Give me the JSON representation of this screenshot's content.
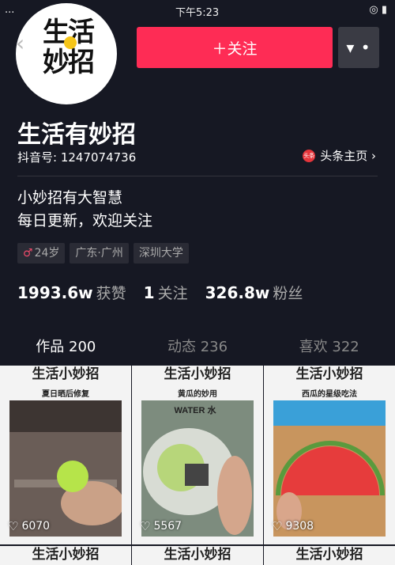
{
  "status": {
    "signal": "...",
    "time": "下午5:23",
    "right": "◎ ▮"
  },
  "avatar": {
    "text": "生活妙招"
  },
  "back_icon": "‹",
  "actions": {
    "follow_label": "＋关注",
    "more_label": "▾ •"
  },
  "profile": {
    "name": "生活有妙招",
    "id_line": "抖音号: 1247074736",
    "toutiao_badge": "头条",
    "toutiao_label": "头条主页 ›",
    "bio": [
      "小妙招有大智慧",
      "每日更新，欢迎关注"
    ],
    "tags": [
      "24岁",
      "广东·广州",
      "深圳大学"
    ]
  },
  "stats": [
    {
      "value": "1993.6w",
      "label": "获赞"
    },
    {
      "value": "1",
      "label": "关注"
    },
    {
      "value": "326.8w",
      "label": "粉丝"
    }
  ],
  "tabs": [
    "作品 200",
    "动态 236",
    "喜欢 322"
  ],
  "videos": [
    {
      "header": "生活小妙招",
      "subtitle": "夏日晒后修复",
      "likes": "6070"
    },
    {
      "header": "生活小妙招",
      "subtitle": "黄瓜的妙用",
      "overlay": "WATER 水",
      "likes": "5567"
    },
    {
      "header": "生活小妙招",
      "subtitle": "西瓜的星级吃法",
      "likes": "9308"
    }
  ],
  "next_row_headers": [
    "生活小妙招",
    "生活小妙招",
    "生活小妙招"
  ],
  "colors": {
    "background": "#161823",
    "accent": "#fe2c55"
  }
}
